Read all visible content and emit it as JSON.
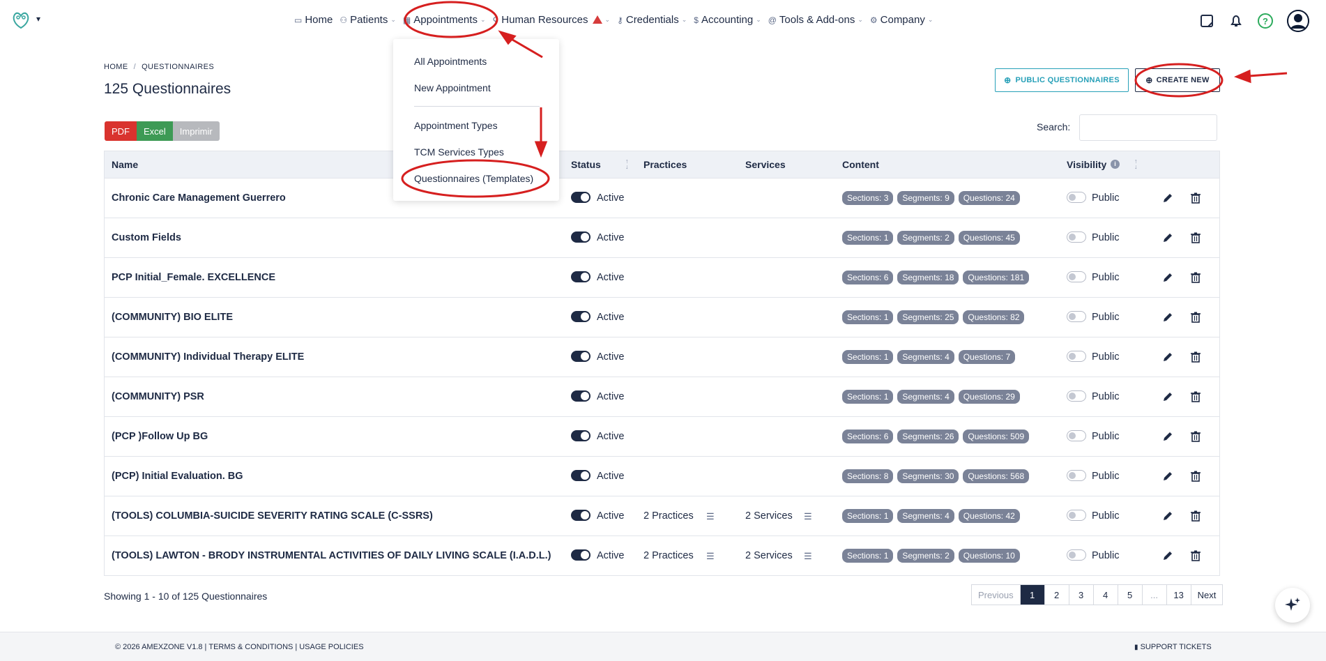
{
  "nav": {
    "items": [
      {
        "label": "Home",
        "icon": "monitor-icon",
        "caret": false
      },
      {
        "label": "Patients",
        "icon": "users-icon",
        "caret": true
      },
      {
        "label": "Appointments",
        "icon": "calendar-icon",
        "caret": true
      },
      {
        "label": "Human Resources",
        "icon": "user-plus-icon",
        "caret": true,
        "warning": true
      },
      {
        "label": "Credentials",
        "icon": "key-icon",
        "caret": true
      },
      {
        "label": "Accounting",
        "icon": "dollar-icon",
        "caret": true
      },
      {
        "label": "Tools & Add-ons",
        "icon": "at-icon",
        "caret": true
      },
      {
        "label": "Company",
        "icon": "gear-icon",
        "caret": true
      }
    ]
  },
  "dropdown": {
    "items": [
      "All Appointments",
      "New Appointment",
      "Appointment Types",
      "TCM Services Types",
      "Questionnaires (Templates)"
    ]
  },
  "breadcrumb": {
    "home": "HOME",
    "current": "QUESTIONNAIRES"
  },
  "page": {
    "title": "125 Questionnaires"
  },
  "buttons": {
    "public": "PUBLIC QUESTIONNAIRES",
    "create": "CREATE NEW"
  },
  "export": {
    "pdf": "PDF",
    "excel": "Excel",
    "print": "Imprimir"
  },
  "search": {
    "label": "Search:",
    "value": ""
  },
  "table": {
    "headers": {
      "name": "Name",
      "status": "Status",
      "practices": "Practices",
      "services": "Services",
      "content": "Content",
      "visibility": "Visibility"
    },
    "rows": [
      {
        "name": "Chronic Care Management Guerrero",
        "status": "Active",
        "practices": "",
        "services": "",
        "sections": "Sections: 3",
        "segments": "Segments: 9",
        "questions": "Questions: 24",
        "visibility": "Public"
      },
      {
        "name": "Custom Fields",
        "status": "Active",
        "practices": "",
        "services": "",
        "sections": "Sections: 1",
        "segments": "Segments: 2",
        "questions": "Questions: 45",
        "visibility": "Public"
      },
      {
        "name": "PCP Initial_Female. EXCELLENCE",
        "status": "Active",
        "practices": "",
        "services": "",
        "sections": "Sections: 6",
        "segments": "Segments: 18",
        "questions": "Questions: 181",
        "visibility": "Public"
      },
      {
        "name": "(COMMUNITY) BIO ELITE",
        "status": "Active",
        "practices": "",
        "services": "",
        "sections": "Sections: 1",
        "segments": "Segments: 25",
        "questions": "Questions: 82",
        "visibility": "Public"
      },
      {
        "name": "(COMMUNITY) Individual Therapy ELITE",
        "status": "Active",
        "practices": "",
        "services": "",
        "sections": "Sections: 1",
        "segments": "Segments: 4",
        "questions": "Questions: 7",
        "visibility": "Public"
      },
      {
        "name": "(COMMUNITY) PSR",
        "status": "Active",
        "practices": "",
        "services": "",
        "sections": "Sections: 1",
        "segments": "Segments: 4",
        "questions": "Questions: 29",
        "visibility": "Public"
      },
      {
        "name": "(PCP )Follow Up BG",
        "status": "Active",
        "practices": "",
        "services": "",
        "sections": "Sections: 6",
        "segments": "Segments: 26",
        "questions": "Questions: 509",
        "visibility": "Public"
      },
      {
        "name": "(PCP) Initial Evaluation. BG",
        "status": "Active",
        "practices": "",
        "services": "",
        "sections": "Sections: 8",
        "segments": "Segments: 30",
        "questions": "Questions: 568",
        "visibility": "Public"
      },
      {
        "name": "(TOOLS) COLUMBIA-SUICIDE SEVERITY RATING SCALE (C-SSRS)",
        "status": "Active",
        "practices": "2 Practices",
        "services": "2 Services",
        "sections": "Sections: 1",
        "segments": "Segments: 4",
        "questions": "Questions: 42",
        "visibility": "Public"
      },
      {
        "name": "(TOOLS) LAWTON - BRODY INSTRUMENTAL ACTIVITIES OF DAILY LIVING SCALE (I.A.D.L.)",
        "status": "Active",
        "practices": "2 Practices",
        "services": "2 Services",
        "sections": "Sections: 1",
        "segments": "Segments: 2",
        "questions": "Questions: 10",
        "visibility": "Public"
      }
    ]
  },
  "pagination": {
    "showing": "Showing 1 - 10 of 125 Questionnaires",
    "pages": [
      "Previous",
      "1",
      "2",
      "3",
      "4",
      "5",
      "...",
      "13",
      "Next"
    ],
    "active": "1"
  },
  "footer": {
    "copyright": "© 2026 AMEXZONE V1.8",
    "terms": "TERMS & CONDITIONS",
    "usage": "USAGE POLICIES",
    "support": "SUPPORT TICKETS"
  },
  "colors": {
    "primary": "#1e2a44",
    "teal": "#27a0b8",
    "annotation": "#d61f1f",
    "badge": "#7a8297"
  }
}
